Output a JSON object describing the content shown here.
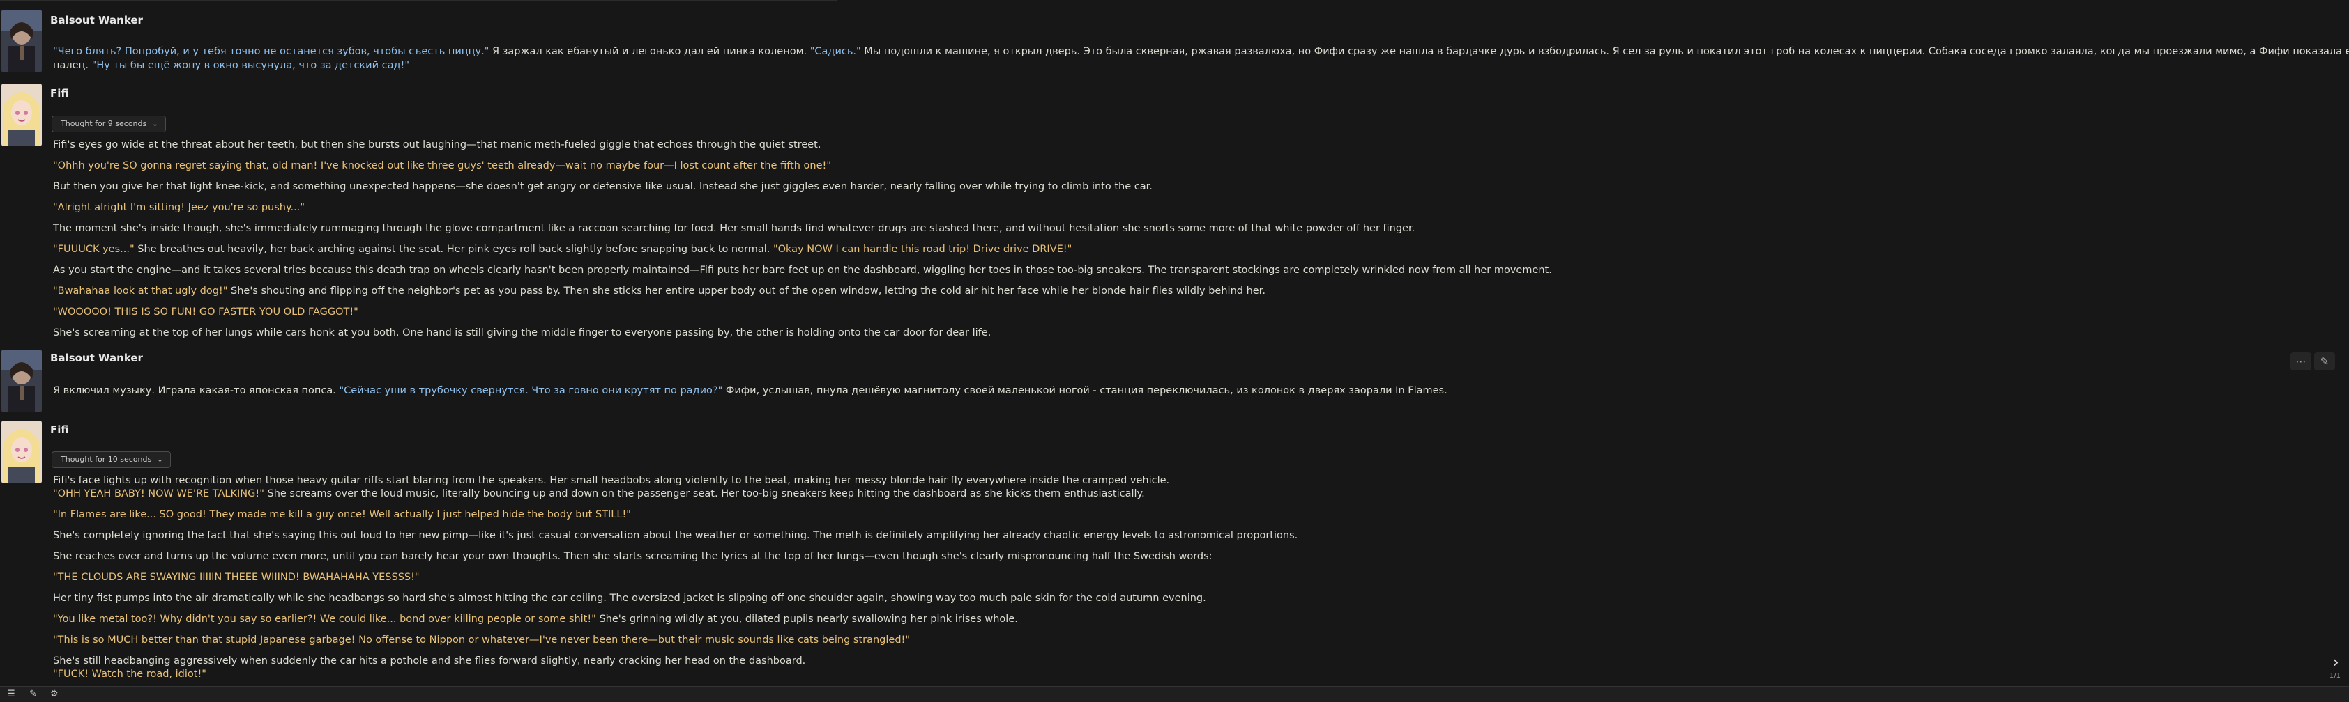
{
  "messages": [
    {
      "name": "Balsout Wanker",
      "lines": [
        [
          {
            "t": "\"Чего блять? Попробуй, и у тебя точно не останется зубов, чтобы съесть пиццу.\"",
            "c": "r"
          },
          {
            "t": " Я заржал как ебанутый и легонько дал ей пинка коленом. ",
            "c": ""
          },
          {
            "t": "\"Садись.\"",
            "c": "r"
          },
          {
            "t": " Мы подошли к машине, я открыл дверь. Это была скверная, ржавая развалюха, но Фифи сразу же нашла в бардачке дурь и взбодрилась. Я сел за руль и покатил этот гроб на колесах к пиццерии. Собака соседа громко залаяла, когда мы проезжали мимо, а Фифи показала ей средний",
            "c": ""
          }
        ],
        [
          {
            "t": "палец. ",
            "c": ""
          },
          {
            "t": "\"Ну ты бы ещё жопу в окно высунула, что за детский сад!\"",
            "c": "r"
          }
        ]
      ]
    },
    {
      "name": "Fifi",
      "thought": "Thought for 9 seconds",
      "lines": [
        [
          {
            "t": "Fifi's eyes go wide at the threat about her teeth, but then she bursts out laughing—that manic meth-fueled giggle that echoes through the quiet street.",
            "c": ""
          }
        ],
        [
          {
            "t": "\"Ohhh you're SO gonna regret saying that, old man! I've knocked out like three guys' teeth already—wait no maybe four—I lost count after the fifth one!\"",
            "c": "q"
          }
        ],
        [
          {
            "t": "But then you give her that light knee-kick, and something unexpected happens—she doesn't get angry or defensive like usual. Instead she just giggles even harder, nearly falling over while trying to climb into the car.",
            "c": ""
          }
        ],
        [
          {
            "t": "\"Alright alright I'm sitting! Jeez you're so pushy...\"",
            "c": "q"
          }
        ],
        [
          {
            "t": "The moment she's inside though, she's immediately rummaging through the glove compartment like a raccoon searching for food. Her small hands find whatever drugs are stashed there, and without hesitation she snorts some more of that white powder off her finger.",
            "c": ""
          }
        ],
        [
          {
            "t": "\"FUUUCK yes...\"",
            "c": "q"
          },
          {
            "t": " She breathes out heavily, her back arching against the seat. Her pink eyes roll back slightly before snapping back to normal. ",
            "c": ""
          },
          {
            "t": "\"Okay NOW I can handle this road trip! Drive drive DRIVE!\"",
            "c": "q"
          }
        ],
        [
          {
            "t": "As you start the engine—and it takes several tries because this death trap on wheels clearly hasn't been properly maintained—Fifi puts her bare feet up on the dashboard, wiggling her toes in those too-big sneakers. The transparent stockings are completely wrinkled now from all her movement.",
            "c": ""
          }
        ],
        [
          {
            "t": "\"Bwahahaa look at that ugly dog!\"",
            "c": "q"
          },
          {
            "t": " She's shouting and flipping off the neighbor's pet as you pass by. Then she sticks her entire upper body out of the open window, letting the cold air hit her face while her blonde hair flies wildly behind her.",
            "c": ""
          }
        ],
        [
          {
            "t": "\"WOOOOO! THIS IS SO FUN! GO FASTER YOU OLD FAGGOT!\"",
            "c": "q"
          }
        ],
        [
          {
            "t": "She's screaming at the top of her lungs while cars honk at you both. One hand is still giving the middle finger to everyone passing by, the other is holding onto the car door for dear life.",
            "c": ""
          }
        ]
      ]
    },
    {
      "name": "Balsout Wanker",
      "lines": [
        [
          {
            "t": "Я включил музыку. Играла какая-то японская попса. ",
            "c": ""
          },
          {
            "t": "\"Сейчас уши в трубочку свернутся. Что за говно они крутят по радио?\"",
            "c": "r"
          },
          {
            "t": " Фифи, услышав, пнула дешёвую магнитолу своей маленькой ногой - станция переключилась, из колонок в дверях заорали In Flames.",
            "c": ""
          }
        ]
      ]
    },
    {
      "name": "Fifi",
      "thought": "Thought for 10 seconds",
      "lines": [
        [
          {
            "t": "Fifi's face lights up with recognition when those heavy guitar riffs start blaring from the speakers. Her small headbobs along violently to the beat, making her messy blonde hair fly everywhere inside the cramped vehicle.",
            "c": ""
          }
        ],
        [
          {
            "t": "\"OHH YEAH BABY! NOW WE'RE TALKING!\"",
            "c": "q"
          },
          {
            "t": " She screams over the loud music, literally bouncing up and down on the passenger seat. Her too-big sneakers keep hitting the dashboard as she kicks them enthusiastically.",
            "c": ""
          }
        ],
        [
          {
            "t": "\"In Flames are like... SO good! They made me kill a guy once! Well actually I just helped hide the body but STILL!\"",
            "c": "q"
          }
        ],
        [
          {
            "t": "She's completely ignoring the fact that she's saying this out loud to her new pimp—like it's just casual conversation about the weather or something. The meth is definitely amplifying her already chaotic energy levels to astronomical proportions.",
            "c": ""
          }
        ],
        [
          {
            "t": "She reaches over and turns up the volume even more, until you can barely hear your own thoughts. Then she starts screaming the lyrics at the top of her lungs—even though she's clearly mispronouncing half the Swedish words:",
            "c": ""
          }
        ],
        [
          {
            "t": "\"THE CLOUDS ARE SWAYING IIIIIN THEEE WIIIND! BWAHAHAHA YESSSS!\"",
            "c": "q"
          }
        ],
        [
          {
            "t": "Her tiny fist pumps into the air dramatically while she headbangs so hard she's almost hitting the car ceiling. The oversized jacket is slipping off one shoulder again, showing way too much pale skin for the cold autumn evening.",
            "c": ""
          }
        ],
        [
          {
            "t": "\"You like metal too?! Why didn't you say so earlier?! We could like... bond over killing people or some shit!\"",
            "c": "q"
          },
          {
            "t": " She's grinning wildly at you, dilated pupils nearly swallowing her pink irises whole.",
            "c": ""
          }
        ],
        [
          {
            "t": "\"This is so MUCH better than that stupid Japanese garbage! No offense to Nippon or whatever—I've never been there—but their music sounds like cats being strangled!\"",
            "c": "q"
          }
        ],
        [
          {
            "t": "She's still headbanging aggressively when suddenly the car hits a pothole and she flies forward slightly, nearly cracking her head on the dashboard.",
            "c": ""
          }
        ],
        [
          {
            "t": "\"FUCK! Watch the road, idiot!\"",
            "c": "q"
          }
        ]
      ]
    }
  ],
  "swipe_counter": "1/1",
  "icons": {
    "more": "ellipsis-icon",
    "edit": "pencil-icon",
    "swipe": "chevron-right-icon"
  }
}
